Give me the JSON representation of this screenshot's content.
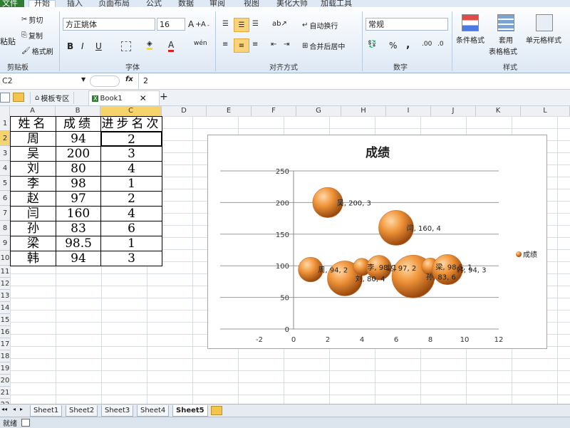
{
  "ribbon": {
    "tabs": [
      "文件",
      "开始",
      "插入",
      "页面布局",
      "公式",
      "数据",
      "审阅",
      "视图",
      "美化大师",
      "加载工具"
    ],
    "clipboard": {
      "paste": "粘贴",
      "cut": "剪切",
      "copy": "复制",
      "format_painter": "格式刷",
      "label": "剪贴板"
    },
    "font": {
      "name": "方正姚体",
      "size": "16",
      "bold": "B",
      "italic": "I",
      "underline": "U",
      "label": "字体"
    },
    "alignment": {
      "wrap": "自动换行",
      "merge": "合并后居中",
      "label": "对齐方式"
    },
    "number": {
      "format": "常规",
      "percent": "%",
      "comma": ",",
      "label": "数字"
    },
    "styles": {
      "conditional": "条件格式",
      "table1": "套用",
      "table2": "表格格式",
      "cell_style": "单元格样式",
      "label": "样式"
    }
  },
  "formula_bar": {
    "name_box": "C2",
    "fx": "fx",
    "value": "2"
  },
  "doc_tabs": {
    "template": "模板专区",
    "book": "Book1"
  },
  "columns": [
    "A",
    "B",
    "C",
    "D",
    "E",
    "F",
    "G",
    "H",
    "I",
    "J",
    "K",
    "L"
  ],
  "rows": [
    "1",
    "2",
    "3",
    "4",
    "5",
    "6",
    "7",
    "8",
    "9",
    "10",
    "11",
    "12",
    "13",
    "14",
    "15",
    "16",
    "17",
    "18",
    "19",
    "20",
    "21",
    "22",
    "23"
  ],
  "table": {
    "headers": [
      "姓名",
      "成绩",
      "进步名次"
    ],
    "rows": [
      [
        "周",
        "94",
        "2"
      ],
      [
        "吴",
        "200",
        "3"
      ],
      [
        "刘",
        "80",
        "4"
      ],
      [
        "李",
        "98",
        "1"
      ],
      [
        "赵",
        "97",
        "2"
      ],
      [
        "闫",
        "160",
        "4"
      ],
      [
        "孙",
        "83",
        "6"
      ],
      [
        "梁",
        "98.5",
        "1"
      ],
      [
        "韩",
        "94",
        "3"
      ]
    ]
  },
  "sheets": [
    "Sheet1",
    "Sheet2",
    "Sheet3",
    "Sheet4",
    "Sheet5"
  ],
  "status": {
    "ready": "就绪"
  },
  "colors": {
    "bubble": "#e8892f",
    "file_tab": "#2f7d32",
    "selected_header": "#f7d36b"
  },
  "chart_data": {
    "type": "scatter",
    "title": "成绩",
    "legend": [
      "成绩"
    ],
    "legend_position": "right",
    "xlim": [
      -2,
      12
    ],
    "ylim": [
      0,
      250
    ],
    "x_ticks": [
      "-2",
      "0",
      "2",
      "4",
      "6",
      "8",
      "10",
      "12"
    ],
    "y_ticks": [
      "0",
      "50",
      "100",
      "150",
      "200",
      "250"
    ],
    "grid": true,
    "series": [
      {
        "name": "成绩",
        "points": [
          {
            "x": 1,
            "y": 94,
            "size": 2,
            "label": "周, 94, 2"
          },
          {
            "x": 2,
            "y": 200,
            "size": 3,
            "label": "吴, 200, 3"
          },
          {
            "x": 3,
            "y": 80,
            "size": 4,
            "label": "刘, 80, 4"
          },
          {
            "x": 4,
            "y": 98,
            "size": 1,
            "label": "李, 98, 1"
          },
          {
            "x": 5,
            "y": 97,
            "size": 2,
            "label": "赵, 97, 2"
          },
          {
            "x": 6,
            "y": 160,
            "size": 4,
            "label": "闫, 160, 4"
          },
          {
            "x": 7,
            "y": 83,
            "size": 6,
            "label": "孙, 83, 6"
          },
          {
            "x": 8,
            "y": 98.5,
            "size": 1,
            "label": "梁, 98.5, 1"
          },
          {
            "x": 9,
            "y": 94,
            "size": 3,
            "label": "韩, 94, 3"
          }
        ]
      }
    ]
  }
}
